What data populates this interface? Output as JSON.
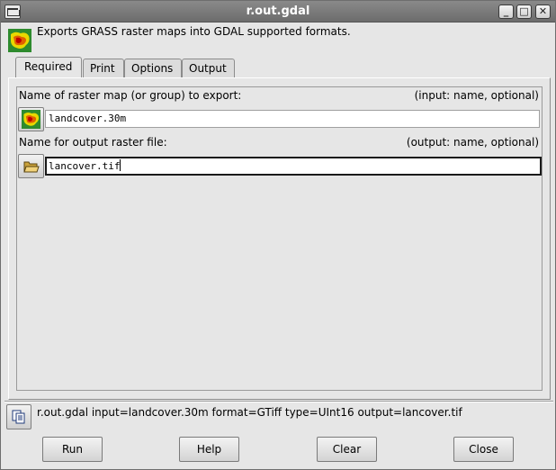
{
  "window": {
    "title": "r.out.gdal"
  },
  "description": "Exports GRASS raster maps into GDAL supported formats.",
  "tabs": [
    {
      "label": "Required",
      "active": true
    },
    {
      "label": "Print",
      "active": false
    },
    {
      "label": "Options",
      "active": false
    },
    {
      "label": "Output",
      "active": false
    }
  ],
  "fields": {
    "input": {
      "label": "Name of raster map (or group) to export:",
      "hint": "(input:  name, optional)",
      "value": "landcover.30m",
      "icon": "raster-map-icon"
    },
    "output": {
      "label": "Name for output raster file:",
      "hint": "(output:  name, optional)",
      "value": "lancover.tif",
      "icon": "folder-open-icon"
    }
  },
  "command": {
    "text": "r.out.gdal input=landcover.30m format=GTiff type=UInt16 output=lancover.tif",
    "icon": "copy-icon"
  },
  "buttons": {
    "run": "Run",
    "help": "Help",
    "clear": "Clear",
    "close": "Close"
  },
  "titlebar_buttons": {
    "minimize": "_",
    "maximize": "□",
    "close": "✕"
  }
}
